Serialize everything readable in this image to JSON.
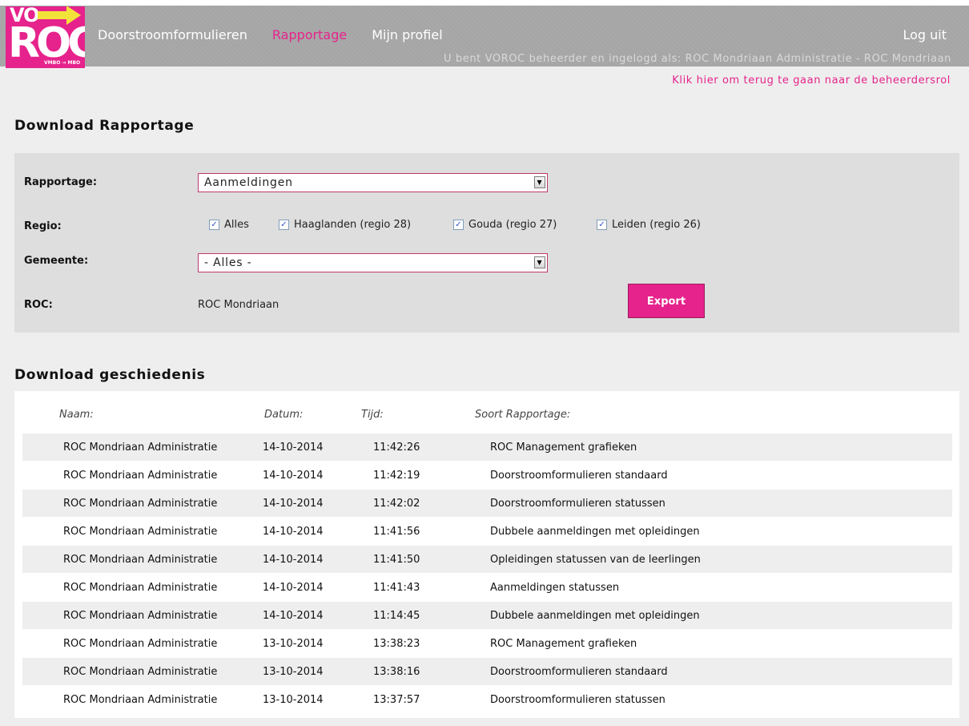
{
  "logo": {
    "top": "VO",
    "main": "ROC",
    "sub": "VMBO → MBO"
  },
  "nav": {
    "items": [
      "Doorstroomformulieren",
      "Rapportage",
      "Mijn profiel"
    ],
    "active": "Rapportage",
    "logout": "Log uit"
  },
  "user_info": "U bent VOROC beheerder en ingelogd als: ROC Mondriaan Administratie - ROC Mondriaan",
  "back_link": "Klik hier om terug te gaan naar de beheerdersrol",
  "download": {
    "title": "Download Rapportage",
    "rapportage_label": "Rapportage:",
    "rapportage_value": "Aanmeldingen",
    "regio_label": "Regio:",
    "regio_options": [
      {
        "label": "Alles",
        "checked": true
      },
      {
        "label": "Haaglanden (regio 28)",
        "checked": true
      },
      {
        "label": "Gouda (regio 27)",
        "checked": true
      },
      {
        "label": "Leiden (regio 26)",
        "checked": true
      }
    ],
    "gemeente_label": "Gemeente:",
    "gemeente_value": "- Alles -",
    "roc_label": "ROC:",
    "roc_value": "ROC Mondriaan",
    "export_label": "Export"
  },
  "history": {
    "title": "Download geschiedenis",
    "columns": [
      "Naam:",
      "Datum:",
      "Tijd:",
      "Soort Rapportage:"
    ],
    "rows": [
      [
        "ROC Mondriaan Administratie",
        "14-10-2014",
        "11:42:26",
        "ROC Management grafieken"
      ],
      [
        "ROC Mondriaan Administratie",
        "14-10-2014",
        "11:42:19",
        "Doorstroomformulieren standaard"
      ],
      [
        "ROC Mondriaan Administratie",
        "14-10-2014",
        "11:42:02",
        "Doorstroomformulieren statussen"
      ],
      [
        "ROC Mondriaan Administratie",
        "14-10-2014",
        "11:41:56",
        "Dubbele aanmeldingen met opleidingen"
      ],
      [
        "ROC Mondriaan Administratie",
        "14-10-2014",
        "11:41:50",
        "Opleidingen statussen van de leerlingen"
      ],
      [
        "ROC Mondriaan Administratie",
        "14-10-2014",
        "11:41:43",
        "Aanmeldingen statussen"
      ],
      [
        "ROC Mondriaan Administratie",
        "14-10-2014",
        "11:14:45",
        "Dubbele aanmeldingen met opleidingen"
      ],
      [
        "ROC Mondriaan Administratie",
        "13-10-2014",
        "13:38:23",
        "ROC Management grafieken"
      ],
      [
        "ROC Mondriaan Administratie",
        "13-10-2014",
        "13:38:16",
        "Doorstroomformulieren standaard"
      ],
      [
        "ROC Mondriaan Administratie",
        "13-10-2014",
        "13:37:57",
        "Doorstroomformulieren statussen"
      ]
    ]
  },
  "colors": {
    "accent": "#e6238c",
    "header": "#a7a7a7",
    "logo_arrow": "#f2e33a"
  }
}
